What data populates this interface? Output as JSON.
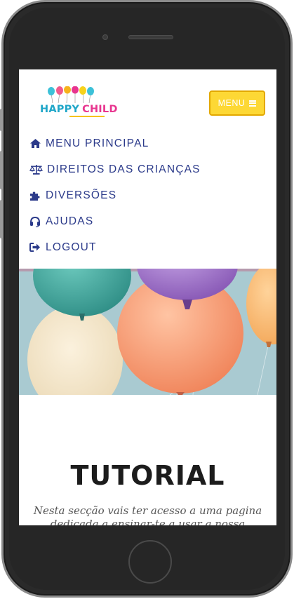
{
  "header": {
    "logo": {
      "word1": "HAPPY",
      "word2": "CHILD"
    },
    "menu_button": {
      "label": "MENU",
      "icon": "hamburger-icon"
    }
  },
  "nav": {
    "items": [
      {
        "label": "MENU PRINCIPAL",
        "icon": "home-icon"
      },
      {
        "label": "DIREITOS DAS CRIANÇAS",
        "icon": "scale-icon"
      },
      {
        "label": "DIVERSÕES",
        "icon": "puzzle-icon"
      },
      {
        "label": "AJUDAS",
        "icon": "headset-icon"
      },
      {
        "label": "LOGOUT",
        "icon": "logout-icon"
      }
    ]
  },
  "banner": {
    "image": "balloons"
  },
  "tutorial": {
    "title": "TUTORIAL",
    "text": "Nesta secção vais ter acesso a uma pagina dedicada a ensinar-te a usar a nossa aplicação."
  },
  "colors": {
    "nav_text": "#2b3a8a",
    "menu_button": "#fdd835",
    "menu_button_border": "#e2a800",
    "logo_happy": "#1fa6c8",
    "logo_child": "#e8358f"
  }
}
